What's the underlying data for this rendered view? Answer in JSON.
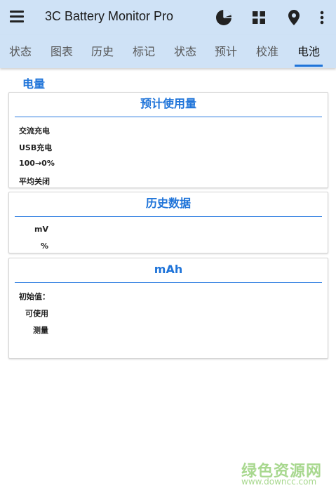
{
  "app": {
    "title": "3C Battery Monitor Pro"
  },
  "toolbar": {
    "icons": [
      "menu-icon",
      "pie-chart-icon",
      "grid-icon",
      "location-pin-icon",
      "more-vert-icon"
    ]
  },
  "tabs": [
    "状态",
    "图表",
    "历史",
    "标记",
    "状态",
    "预计",
    "校准",
    "电池"
  ],
  "active_tab": "电池",
  "section_title": "电量",
  "cards": {
    "estimate": {
      "title": "预计使用量",
      "rows": [
        "交流充电",
        "USB充电",
        "100→0%",
        "平均关闭"
      ]
    },
    "history": {
      "title": "历史数据",
      "rows": [
        "mV",
        "%"
      ]
    },
    "mah": {
      "title": "mAh",
      "rows": [
        "初始值：",
        "可使用",
        "测量"
      ]
    }
  },
  "watermark": {
    "main": "绿色资源网",
    "sub": "www.downcc.com"
  },
  "colors": {
    "appbar": "#cfe2f6",
    "accent": "#1f74d9",
    "watermark": "#a8d88f"
  }
}
